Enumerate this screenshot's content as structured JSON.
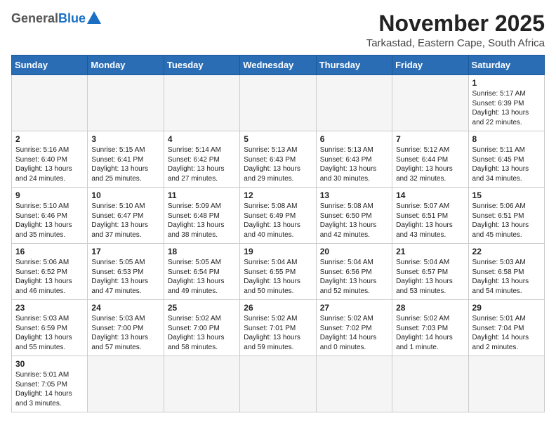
{
  "header": {
    "logo_general": "General",
    "logo_blue": "Blue",
    "month": "November 2025",
    "location": "Tarkastad, Eastern Cape, South Africa"
  },
  "weekdays": [
    "Sunday",
    "Monday",
    "Tuesday",
    "Wednesday",
    "Thursday",
    "Friday",
    "Saturday"
  ],
  "weeks": [
    [
      {
        "day": "",
        "empty": true
      },
      {
        "day": "",
        "empty": true
      },
      {
        "day": "",
        "empty": true
      },
      {
        "day": "",
        "empty": true
      },
      {
        "day": "",
        "empty": true
      },
      {
        "day": "",
        "empty": true
      },
      {
        "day": "1",
        "sunrise": "5:17 AM",
        "sunset": "6:39 PM",
        "daylight": "13 hours and 22 minutes."
      }
    ],
    [
      {
        "day": "2",
        "sunrise": "5:16 AM",
        "sunset": "6:40 PM",
        "daylight": "13 hours and 24 minutes."
      },
      {
        "day": "3",
        "sunrise": "5:15 AM",
        "sunset": "6:41 PM",
        "daylight": "13 hours and 25 minutes."
      },
      {
        "day": "4",
        "sunrise": "5:14 AM",
        "sunset": "6:42 PM",
        "daylight": "13 hours and 27 minutes."
      },
      {
        "day": "5",
        "sunrise": "5:13 AM",
        "sunset": "6:43 PM",
        "daylight": "13 hours and 29 minutes."
      },
      {
        "day": "6",
        "sunrise": "5:13 AM",
        "sunset": "6:43 PM",
        "daylight": "13 hours and 30 minutes."
      },
      {
        "day": "7",
        "sunrise": "5:12 AM",
        "sunset": "6:44 PM",
        "daylight": "13 hours and 32 minutes."
      },
      {
        "day": "8",
        "sunrise": "5:11 AM",
        "sunset": "6:45 PM",
        "daylight": "13 hours and 34 minutes."
      }
    ],
    [
      {
        "day": "9",
        "sunrise": "5:10 AM",
        "sunset": "6:46 PM",
        "daylight": "13 hours and 35 minutes."
      },
      {
        "day": "10",
        "sunrise": "5:10 AM",
        "sunset": "6:47 PM",
        "daylight": "13 hours and 37 minutes."
      },
      {
        "day": "11",
        "sunrise": "5:09 AM",
        "sunset": "6:48 PM",
        "daylight": "13 hours and 38 minutes."
      },
      {
        "day": "12",
        "sunrise": "5:08 AM",
        "sunset": "6:49 PM",
        "daylight": "13 hours and 40 minutes."
      },
      {
        "day": "13",
        "sunrise": "5:08 AM",
        "sunset": "6:50 PM",
        "daylight": "13 hours and 42 minutes."
      },
      {
        "day": "14",
        "sunrise": "5:07 AM",
        "sunset": "6:51 PM",
        "daylight": "13 hours and 43 minutes."
      },
      {
        "day": "15",
        "sunrise": "5:06 AM",
        "sunset": "6:51 PM",
        "daylight": "13 hours and 45 minutes."
      }
    ],
    [
      {
        "day": "16",
        "sunrise": "5:06 AM",
        "sunset": "6:52 PM",
        "daylight": "13 hours and 46 minutes."
      },
      {
        "day": "17",
        "sunrise": "5:05 AM",
        "sunset": "6:53 PM",
        "daylight": "13 hours and 47 minutes."
      },
      {
        "day": "18",
        "sunrise": "5:05 AM",
        "sunset": "6:54 PM",
        "daylight": "13 hours and 49 minutes."
      },
      {
        "day": "19",
        "sunrise": "5:04 AM",
        "sunset": "6:55 PM",
        "daylight": "13 hours and 50 minutes."
      },
      {
        "day": "20",
        "sunrise": "5:04 AM",
        "sunset": "6:56 PM",
        "daylight": "13 hours and 52 minutes."
      },
      {
        "day": "21",
        "sunrise": "5:04 AM",
        "sunset": "6:57 PM",
        "daylight": "13 hours and 53 minutes."
      },
      {
        "day": "22",
        "sunrise": "5:03 AM",
        "sunset": "6:58 PM",
        "daylight": "13 hours and 54 minutes."
      }
    ],
    [
      {
        "day": "23",
        "sunrise": "5:03 AM",
        "sunset": "6:59 PM",
        "daylight": "13 hours and 55 minutes."
      },
      {
        "day": "24",
        "sunrise": "5:03 AM",
        "sunset": "7:00 PM",
        "daylight": "13 hours and 57 minutes."
      },
      {
        "day": "25",
        "sunrise": "5:02 AM",
        "sunset": "7:00 PM",
        "daylight": "13 hours and 58 minutes."
      },
      {
        "day": "26",
        "sunrise": "5:02 AM",
        "sunset": "7:01 PM",
        "daylight": "13 hours and 59 minutes."
      },
      {
        "day": "27",
        "sunrise": "5:02 AM",
        "sunset": "7:02 PM",
        "daylight": "14 hours and 0 minutes."
      },
      {
        "day": "28",
        "sunrise": "5:02 AM",
        "sunset": "7:03 PM",
        "daylight": "14 hours and 1 minute."
      },
      {
        "day": "29",
        "sunrise": "5:01 AM",
        "sunset": "7:04 PM",
        "daylight": "14 hours and 2 minutes."
      }
    ],
    [
      {
        "day": "30",
        "sunrise": "5:01 AM",
        "sunset": "7:05 PM",
        "daylight": "14 hours and 3 minutes."
      },
      {
        "day": "",
        "empty": true
      },
      {
        "day": "",
        "empty": true
      },
      {
        "day": "",
        "empty": true
      },
      {
        "day": "",
        "empty": true
      },
      {
        "day": "",
        "empty": true
      },
      {
        "day": "",
        "empty": true
      }
    ]
  ]
}
